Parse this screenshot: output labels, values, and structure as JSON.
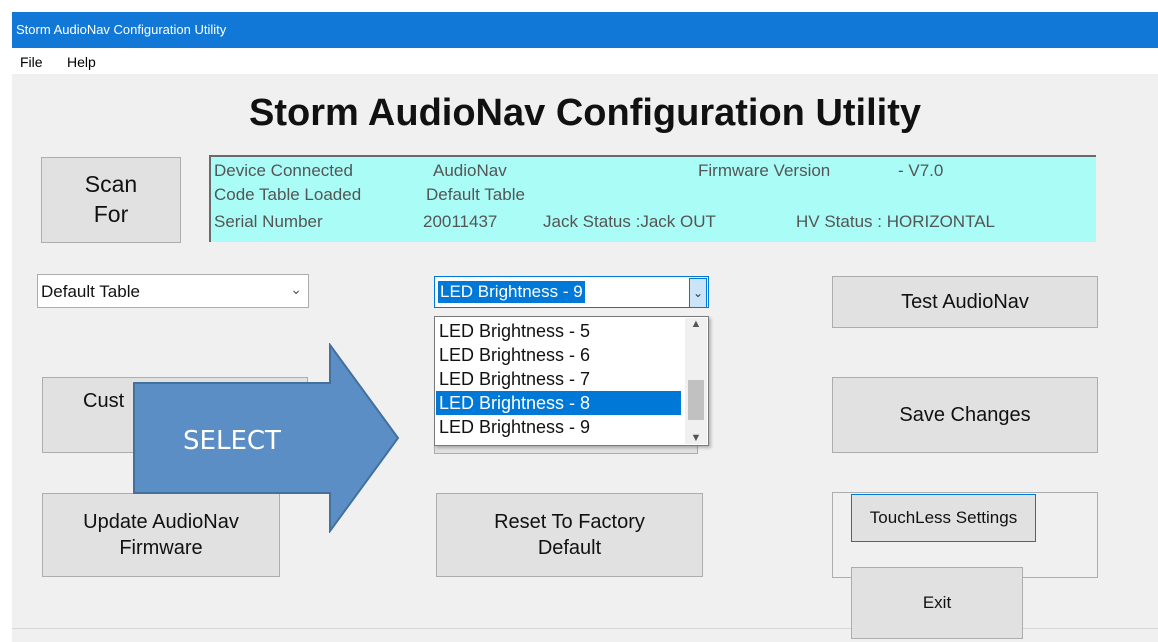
{
  "window": {
    "title": "Storm AudioNav Configuration Utility"
  },
  "menu": {
    "file": "File",
    "help": "Help"
  },
  "heading": "Storm AudioNav Configuration Utility",
  "scan_button": {
    "line1": "Scan",
    "line2": "For"
  },
  "status": {
    "device_connected_label": "Device Connected",
    "device_connected_value": "AudioNav",
    "firmware_label": "Firmware Version",
    "firmware_value": "-  V7.0",
    "code_table_label": "Code Table Loaded",
    "code_table_value": "Default Table",
    "serial_label": "Serial Number",
    "serial_value": "20011437",
    "jack_status": "Jack Status :Jack OUT",
    "hv_status": "HV Status : HORIZONTAL"
  },
  "code_table_select": {
    "value": "Default Table"
  },
  "led_select": {
    "value": "LED Brightness - 9",
    "options": [
      "LED Brightness - 5",
      "LED Brightness - 6",
      "LED Brightness - 7",
      "LED Brightness - 8",
      "LED Brightness - 9"
    ],
    "highlighted": "LED Brightness - 8"
  },
  "buttons": {
    "test": "Test AudioNav",
    "customize_partial": "Cust",
    "save": "Save Changes",
    "update_line1": "Update AudioNav",
    "update_line2": "Firmware",
    "reset_line1": "Reset To Factory",
    "reset_line2": "Default",
    "touchless": "TouchLess Settings",
    "exit": "Exit"
  },
  "annotation": {
    "label": "SELECT",
    "color": "#5b8ec5"
  },
  "colors": {
    "titlebar": "#1178d7",
    "status_bg": "#aafcf7",
    "selection": "#0078d7"
  }
}
